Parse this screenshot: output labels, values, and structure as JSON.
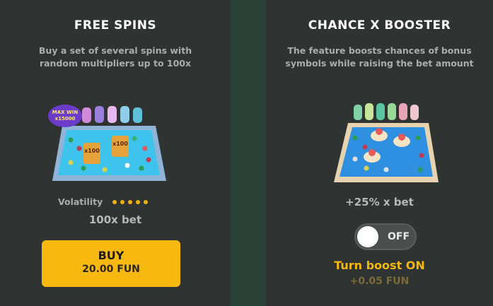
{
  "colors": {
    "accent": "#f7b80f",
    "panel_bg": "#2f3331",
    "text_muted": "#a9aeab"
  },
  "free_spins": {
    "title": "FREE SPINS",
    "description_line1": "Buy a set of several spins with",
    "description_line2": "random multipliers up to 100x",
    "art": {
      "badge_line1": "MAX WIN",
      "badge_line2": "x15000",
      "multiplier_label_1": "x100",
      "multiplier_label_2": "x100"
    },
    "volatility_label": "Volatility",
    "volatility_level": 5,
    "volatility_max": 5,
    "bet_label": "100x bet",
    "buy_button": {
      "label": "BUY",
      "price": "20.00 FUN"
    }
  },
  "chance_booster": {
    "title": "CHANCE X BOOSTER",
    "description_line1": "The feature boosts chances of bonus",
    "description_line2": "symbols while raising the bet amount",
    "bet_label": "+25% x bet",
    "toggle_state": "OFF",
    "boost_label": "Turn boost ON",
    "boost_price": "+0.05 FUN"
  }
}
